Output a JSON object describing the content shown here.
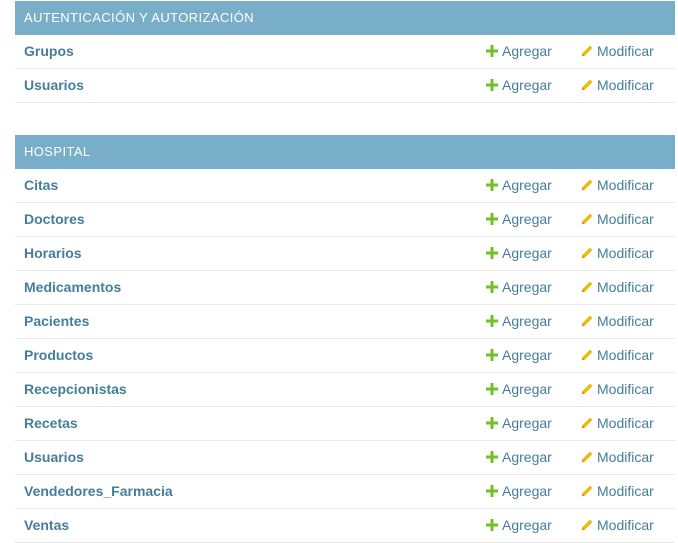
{
  "colors": {
    "caption_bg": "#79aec8",
    "link": "#447e9b",
    "add_icon": "#70bf2b",
    "change_icon": "#efb80b"
  },
  "labels": {
    "add": "Agregar",
    "change": "Modificar"
  },
  "modules": [
    {
      "caption": "Autenticación y autorización",
      "models": [
        {
          "name": "Grupos"
        },
        {
          "name": "Usuarios"
        }
      ]
    },
    {
      "caption": "Hospital",
      "models": [
        {
          "name": "Citas"
        },
        {
          "name": "Doctores"
        },
        {
          "name": "Horarios"
        },
        {
          "name": "Medicamentos"
        },
        {
          "name": "Pacientes"
        },
        {
          "name": "Productos"
        },
        {
          "name": "Recepcionistas"
        },
        {
          "name": "Recetas"
        },
        {
          "name": "Usuarios"
        },
        {
          "name": "Vendedores_Farmacia"
        },
        {
          "name": "Ventas"
        }
      ]
    }
  ]
}
